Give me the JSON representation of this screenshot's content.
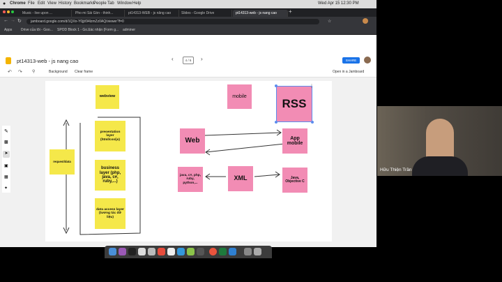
{
  "menubar": {
    "apple": "",
    "items": [
      "Chrome",
      "File",
      "Edit",
      "View",
      "History",
      "Bookmarks",
      "People",
      "Tab",
      "Window",
      "Help"
    ],
    "clock": "Wed Apr 15  12:30 PM"
  },
  "tabs": [
    {
      "label": "Music - live upon ...",
      "active": false
    },
    {
      "label": "Pho mi Sài Gòn - thinh...",
      "active": false
    },
    {
      "label": "pt14313-WEB - js nâng cao",
      "active": false
    },
    {
      "label": "Slides - Google Drive",
      "active": false
    },
    {
      "label": "pt14313-web - js nang cao",
      "active": true
    }
  ],
  "address": {
    "url": "jamboard.google.com/d/1QXn-Y0jjt/94lzmZz0AQ/viewer?f=0"
  },
  "bookmarks": [
    "Apps",
    "Drive của tôi - Goo...",
    "SPOD Block 1 - Go...",
    "Xác nhận (Form g...",
    "adminer"
  ],
  "jamboard": {
    "title": "pt14313-web - js nang cao",
    "frame_indicator": "4 / 6",
    "share_label": "SHARE",
    "background_label": "Background",
    "clear_frame_label": "Clear frame",
    "open_label": "Open in a Jamboard"
  },
  "notes": {
    "webview": "webview",
    "presentation": "presentation layer (html/css/js)",
    "business": "business layer (php, java, c#, ruby,...)",
    "data_access": "data access layer (tương tác dữ liệu)",
    "request": "request/data",
    "mobile": "mobile",
    "rss": "RSS",
    "web": "Web",
    "app_mobile": "App mobile",
    "java_list": "java, c#, php, ruby, python,...",
    "xml": "XML",
    "java_objc": "Java, Objective C"
  },
  "video": {
    "name": "Hữu Thiện Trần"
  }
}
